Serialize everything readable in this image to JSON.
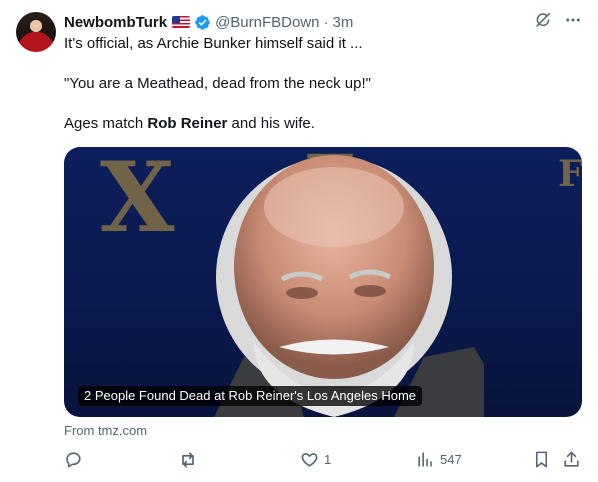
{
  "author": {
    "name": "NewbombTurk",
    "handle": "@BurnFBDown",
    "separator": "·",
    "time": "3m"
  },
  "post": {
    "line1": "It's official, as Archie Bunker himself said it ...",
    "line2": "\"You are a Meathead, dead from the neck up!\"",
    "line3_before": "Ages match ",
    "line3_bold": "Rob Reiner",
    "line3_after": " and his wife."
  },
  "card": {
    "caption": "2 People Found Dead at Rob Reiner's Los Angeles Home",
    "source": "From tmz.com"
  },
  "actions": {
    "reply_count": "",
    "repost_count": "",
    "like_count": "1",
    "views_count": "547"
  },
  "icons": {
    "flag": "us-flag-icon",
    "verified": "verified-badge-icon",
    "grok": "grok-icon",
    "more": "more-icon",
    "reply": "reply-icon",
    "repost": "repost-icon",
    "like": "heart-icon",
    "views": "views-icon",
    "bookmark": "bookmark-icon",
    "share": "share-icon"
  },
  "colors": {
    "text": "#0f1419",
    "muted": "#536471",
    "verified": "#1d9bf0"
  }
}
